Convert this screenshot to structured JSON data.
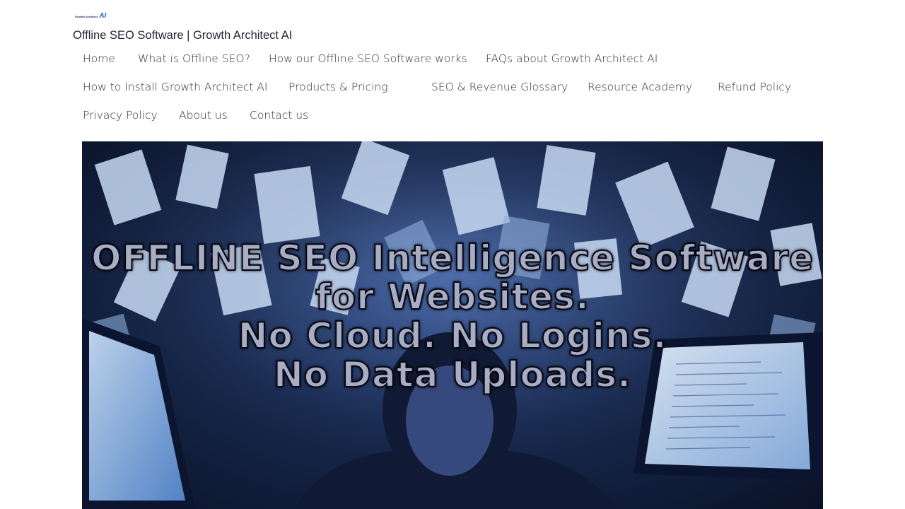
{
  "logo": {
    "wordmark": "Growth Architect",
    "mark": "AI"
  },
  "site_title": "Offline SEO Software | Growth Architect AI",
  "nav": {
    "home": "Home",
    "what_is": "What is Offline SEO?",
    "how_works": "How our Offline SEO Software works",
    "faqs": "FAQs about Growth Architect AI",
    "install": "How to Install Growth Architect AI",
    "products": "Products & Pricing",
    "glossary": "SEO & Revenue Glossary",
    "academy": "Resource Academy",
    "refund": "Refund Policy",
    "privacy": "Privacy Policy",
    "about": "About us",
    "contact": "Contact us"
  },
  "hero": {
    "line1": "OFFLINE SEO Intelligence Software",
    "line2": "for Websites.",
    "line3": "No Cloud. No Logins.",
    "line4": "No Data Uploads."
  }
}
